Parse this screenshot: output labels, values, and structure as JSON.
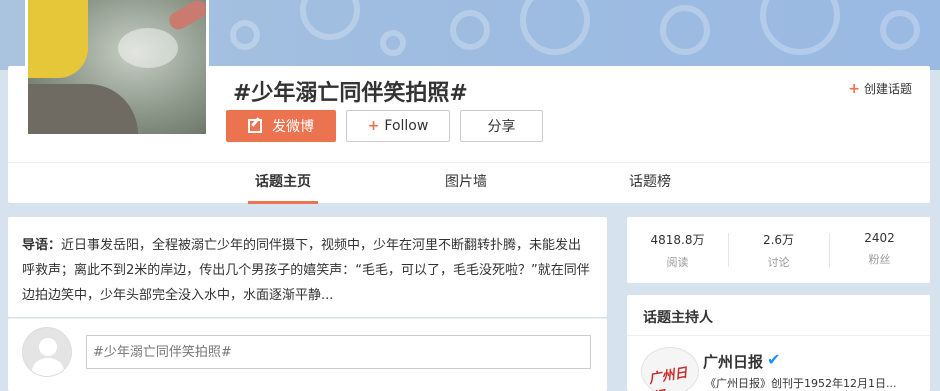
{
  "topic": {
    "title": "#少年溺亡同伴笑拍照#",
    "create_label": "创建话题"
  },
  "actions": {
    "post_label": "发微博",
    "follow_label": "Follow",
    "share_label": "分享"
  },
  "tabs": [
    {
      "label": "话题主页",
      "active": true
    },
    {
      "label": "图片墙",
      "active": false
    },
    {
      "label": "话题榜",
      "active": false
    }
  ],
  "intro": {
    "lead": "导语：",
    "text": "近日事发岳阳，全程被溺亡少年的同伴摄下，视频中，少年在河里不断翻转扑腾，未能发出呼救声；离此不到2米的岸边，传出几个男孩子的嬉笑声：“毛毛，可以了，毛毛没死啦？”就在同伴边拍边笑中，少年头部完全没入水中，水面逐渐平静..."
  },
  "comment": {
    "placeholder": "#少年溺亡同伴笑拍照#"
  },
  "stats": [
    {
      "value": "4818.8万",
      "label": "阅读"
    },
    {
      "value": "2.6万",
      "label": "讨论"
    },
    {
      "value": "2402",
      "label": "粉丝"
    }
  ],
  "host": {
    "section_title": "话题主持人",
    "name": "广州日报",
    "logo_text": "广州日报",
    "description": "《广州日报》创刊于1952年12月1日..."
  },
  "colors": {
    "accent": "#eb7350",
    "verify": "#1e90ff"
  }
}
